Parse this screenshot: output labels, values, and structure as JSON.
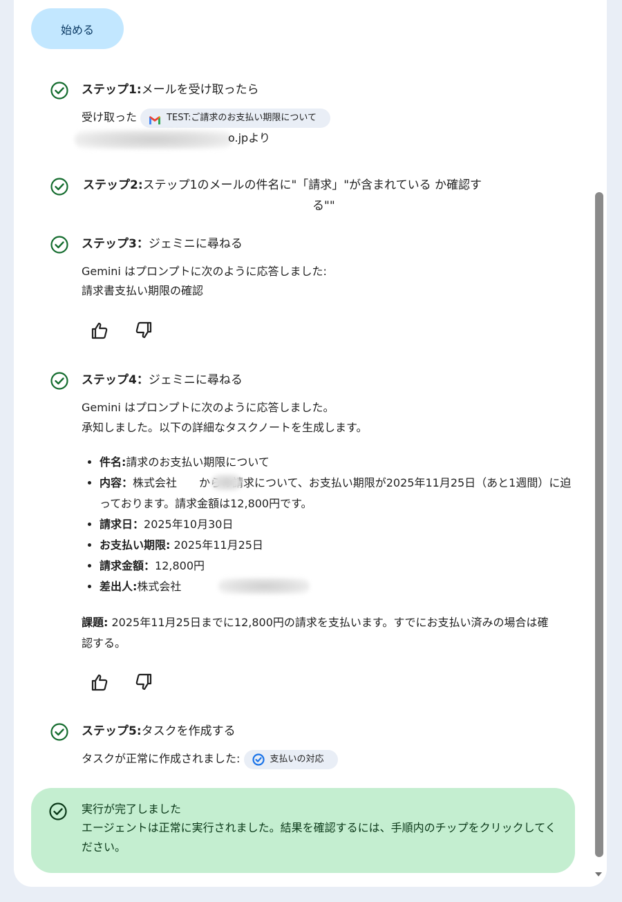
{
  "start_button": "始める",
  "steps": [
    {
      "title_bold": "ステップ1:",
      "title_rest": "メールを受け取ったら",
      "line1_prefix": "受け取った",
      "chip_label": "TEST:ご請求のお支払い期限について",
      "line2_suffix": "o.jpより"
    },
    {
      "title_bold": "ステップ2:",
      "title_rest": "ステップ1のメールの件名に\"「請求」\"が含まれている か確認す",
      "title_rest_line2": "る\"\""
    },
    {
      "title_bold": "ステップ3：",
      "title_rest": "ジェミニに尋ねる",
      "line1": "Gemini はプロンプトに次のように応答しました:",
      "line2": "請求書支払い期限の確認"
    },
    {
      "title_bold": "ステップ4：",
      "title_rest": "ジェミニに尋ねる",
      "line1": "Gemini はプロンプトに次のように応答しました。",
      "line2": "承知しました。以下の詳細なタスクノートを生成します。",
      "notes": [
        {
          "label": "件名:",
          "text": "請求のお支払い期限について"
        },
        {
          "label": "内容：",
          "text": "株式会社　　からの請求について、お支払い期限が2025年11月25日（あと1週間）に迫っております。請求金額は12,800円です。"
        },
        {
          "label": "請求日：",
          "text": "2025年10月30日"
        },
        {
          "label": "お支払い期限:",
          "text": " 2025年11月25日"
        },
        {
          "label": "請求金額：",
          "text": "12,800円"
        },
        {
          "label": "差出人:",
          "text": "株式会社"
        }
      ],
      "task_label": "課題:",
      "task_text": " 2025年11月25日までに12,800円の請求を支払います。すでにお支払い済みの場合は確認する。"
    },
    {
      "title_bold": "ステップ5:",
      "title_rest": "タスクを作成する",
      "line1_prefix": "タスクが正常に作成されました:",
      "chip_label": "支払いの対応"
    }
  ],
  "result": {
    "title": "実行が完了しました",
    "body": "エージェントは正常に実行されました。結果を確認するには、手順内のチップをクリックしてください。"
  },
  "icons": {
    "check": "check-circle-icon",
    "gmail": "gmail-icon",
    "tasks": "tasks-icon",
    "thumb_up": "thumb-up-icon",
    "thumb_down": "thumb-down-icon"
  },
  "colors": {
    "check_green": "#146c2e",
    "start_button_bg": "#c2e7ff",
    "result_bg": "#c4eed0",
    "chip_bg": "#e9eef6"
  }
}
